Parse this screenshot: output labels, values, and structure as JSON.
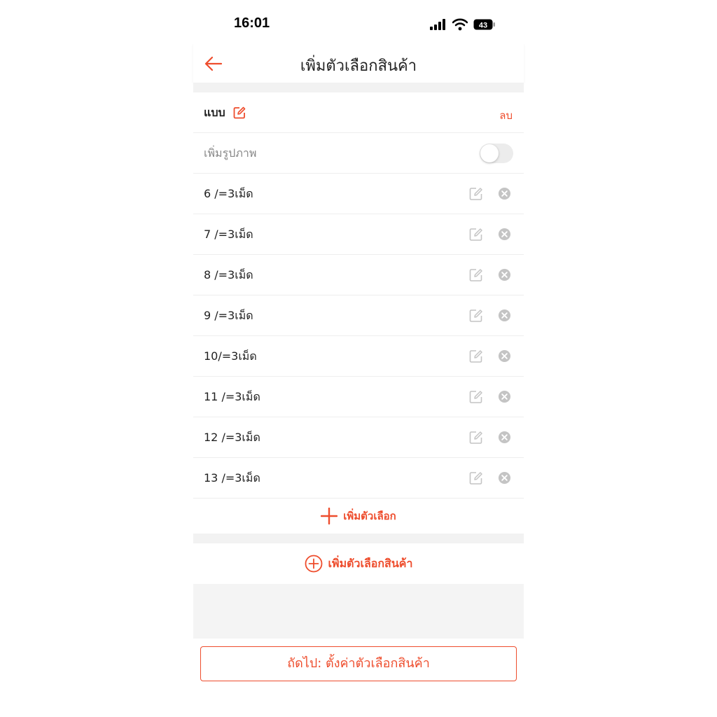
{
  "status_bar": {
    "time": "16:01",
    "battery_level": "43"
  },
  "header": {
    "title": "เพิ่มตัวเลือกสินค้า",
    "back_icon": "arrow-left-icon"
  },
  "variation_group": {
    "name": "แบบ",
    "delete_label": "ลบ",
    "add_image_label": "เพิ่มรูปภาพ",
    "add_image_enabled": false,
    "options": [
      "6 /=3เม็ด",
      "7 /=3เม็ด",
      "8 /=3เม็ด",
      "9 /=3เม็ด",
      "10/=3เม็ด",
      "11 /=3เม็ด",
      "12 /=3เม็ด",
      "13 /=3เม็ด"
    ],
    "add_option_label": "เพิ่มตัวเลือก"
  },
  "add_variation_label": "เพิ่มตัวเลือกสินค้า",
  "footer": {
    "next_label": "ถัดไป: ตั้งค่าตัวเลือกสินค้า"
  },
  "colors": {
    "accent": "#ee4d2d",
    "icon_grey": "#c4c4c4",
    "divider": "#eeeeee",
    "background_grey": "#f2f2f2"
  }
}
